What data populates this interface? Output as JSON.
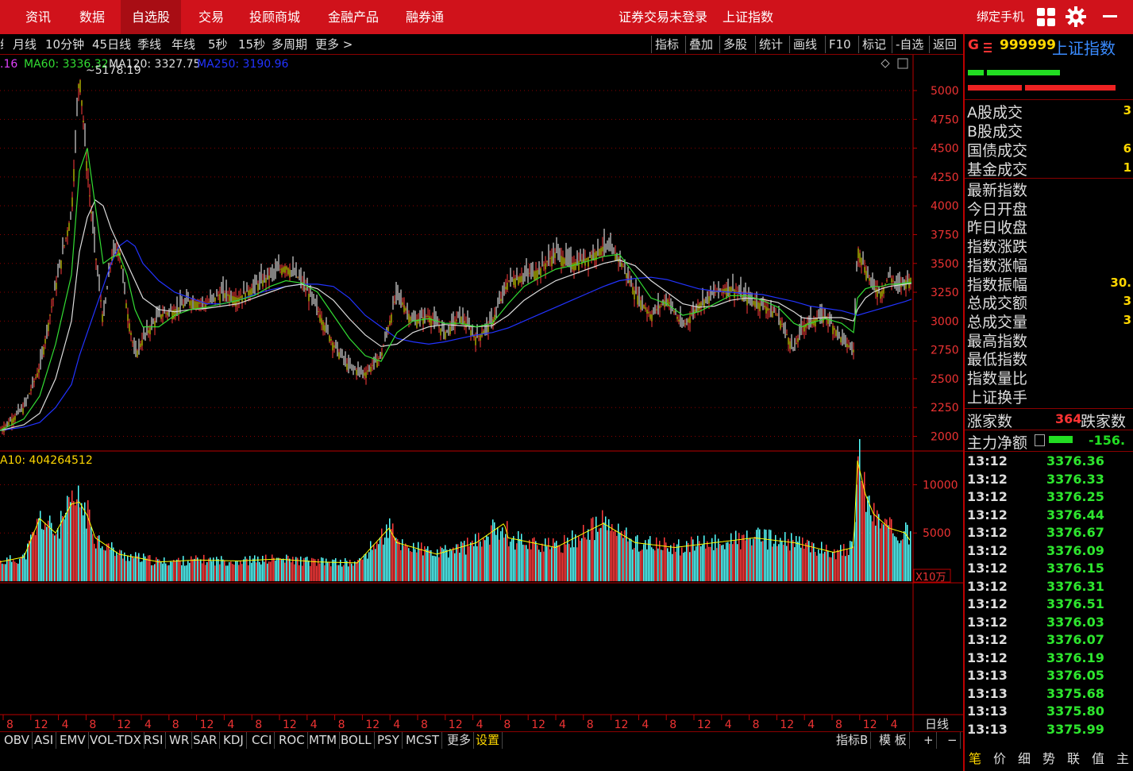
{
  "topbar": {
    "nav": [
      "资讯",
      "数据",
      "自选股",
      "交易",
      "投顾商城",
      "金融产品",
      "融券通"
    ],
    "active_index": 2,
    "login_status": "证券交易未登录",
    "index_name": "上证指数",
    "bind_phone": "绑定手机",
    "accent": "#d0121b"
  },
  "toolbar": {
    "periods": [
      "月线",
      "10分钟",
      "45日线",
      "季线",
      "年线",
      "5秒",
      "15秒",
      "多周期",
      "更多 >"
    ],
    "tools": [
      "指标",
      "叠加",
      "多股",
      "统计",
      "画线",
      "F10",
      "标记",
      "-自选",
      "返回"
    ]
  },
  "chart_data": [
    {
      "type": "line",
      "title": "",
      "legend": [
        {
          "name": ".16",
          "color": "#e040fb"
        },
        {
          "name": "MA60: 3336.32",
          "color": "#33dd33"
        },
        {
          "name": "MA120: 3327.75",
          "color": "#dddddd"
        },
        {
          "name": "MA250: 3190.96",
          "color": "#2233ff"
        }
      ],
      "ylim": [
        1900,
        5200
      ],
      "yticks": [
        5000,
        4750,
        4500,
        4250,
        4000,
        3750,
        3500,
        3250,
        3000,
        2750,
        2500,
        2250,
        2000
      ],
      "peak_label": "5178.19",
      "x": [
        0,
        30,
        50,
        70,
        90,
        100,
        110,
        120,
        130,
        140,
        150,
        160,
        170,
        180,
        200,
        220,
        240,
        260,
        280,
        300,
        320,
        340,
        360,
        380,
        400,
        420,
        440,
        460,
        480,
        500,
        520,
        540,
        560,
        580,
        600,
        620,
        640,
        660,
        680,
        700,
        720,
        740,
        760,
        780,
        800,
        820,
        840,
        860,
        880,
        900,
        920,
        940,
        960,
        980,
        1000,
        1010,
        1020,
        1040,
        1060,
        1075,
        1080,
        1090,
        1100,
        1110,
        1120,
        1130,
        1140,
        1148
      ],
      "close": [
        2050,
        2250,
        2600,
        3300,
        3950,
        5178,
        4300,
        3600,
        3000,
        3550,
        3650,
        3100,
        2700,
        2850,
        3050,
        3100,
        3180,
        3150,
        3250,
        3200,
        3300,
        3400,
        3480,
        3350,
        3100,
        2800,
        2600,
        2550,
        2700,
        3250,
        3000,
        3050,
        2900,
        3050,
        2850,
        3000,
        3350,
        3400,
        3450,
        3600,
        3500,
        3550,
        3650,
        3550,
        3250,
        3050,
        3200,
        2950,
        3150,
        3250,
        3300,
        3200,
        3150,
        3050,
        2750,
        2950,
        3000,
        3050,
        2850,
        2750,
        3650,
        3450,
        3300,
        3250,
        3400,
        3300,
        3350,
        3380
      ],
      "ma60": [
        2050,
        2150,
        2350,
        2800,
        3400,
        4300,
        4500,
        4000,
        3500,
        3550,
        3580,
        3400,
        3100,
        2950,
        2950,
        3050,
        3100,
        3120,
        3150,
        3180,
        3220,
        3300,
        3350,
        3330,
        3250,
        3050,
        2850,
        2700,
        2650,
        2900,
        3000,
        3020,
        2980,
        2980,
        2950,
        2980,
        3150,
        3300,
        3380,
        3450,
        3480,
        3520,
        3560,
        3580,
        3400,
        3200,
        3150,
        3050,
        3080,
        3150,
        3220,
        3220,
        3180,
        3120,
        2980,
        2950,
        2980,
        3020,
        2980,
        2900,
        3200,
        3280,
        3300,
        3300,
        3320,
        3320,
        3330,
        3336
      ],
      "ma120": [
        2050,
        2100,
        2200,
        2500,
        3000,
        3600,
        3900,
        4050,
        4000,
        3800,
        3650,
        3500,
        3350,
        3200,
        3100,
        3080,
        3100,
        3110,
        3130,
        3150,
        3200,
        3250,
        3300,
        3320,
        3280,
        3180,
        3020,
        2880,
        2780,
        2800,
        2900,
        2950,
        2970,
        2960,
        2950,
        2960,
        3050,
        3180,
        3270,
        3350,
        3400,
        3450,
        3500,
        3530,
        3480,
        3350,
        3250,
        3150,
        3120,
        3130,
        3180,
        3200,
        3190,
        3160,
        3080,
        3030,
        3020,
        3030,
        3030,
        3000,
        3100,
        3200,
        3250,
        3280,
        3300,
        3310,
        3320,
        3327
      ],
      "ma250": [
        2050,
        2080,
        2120,
        2250,
        2450,
        2700,
        2900,
        3100,
        3300,
        3500,
        3650,
        3700,
        3650,
        3500,
        3350,
        3250,
        3200,
        3150,
        3150,
        3180,
        3230,
        3270,
        3300,
        3320,
        3320,
        3300,
        3200,
        3050,
        2950,
        2850,
        2820,
        2800,
        2820,
        2850,
        2880,
        2900,
        2940,
        3000,
        3060,
        3120,
        3180,
        3240,
        3300,
        3350,
        3370,
        3380,
        3360,
        3320,
        3280,
        3260,
        3250,
        3240,
        3230,
        3200,
        3170,
        3150,
        3130,
        3110,
        3090,
        3060,
        3050,
        3070,
        3090,
        3110,
        3130,
        3150,
        3170,
        3190
      ]
    },
    {
      "type": "bar",
      "title": "",
      "legend_label": "A10: 404264512",
      "unit_label": "X10万",
      "ylim": [
        0,
        13000
      ],
      "yticks": [
        10000,
        5000
      ],
      "x": [
        0,
        30,
        50,
        70,
        90,
        100,
        110,
        120,
        150,
        200,
        250,
        300,
        350,
        400,
        450,
        490,
        500,
        550,
        600,
        635,
        640,
        700,
        760,
        800,
        850,
        900,
        950,
        1000,
        1050,
        1075,
        1080,
        1090,
        1100,
        1120,
        1140,
        1148
      ],
      "values": [
        2000,
        2500,
        6500,
        5000,
        8000,
        8200,
        6800,
        4500,
        2800,
        2000,
        2200,
        2100,
        2300,
        2000,
        1900,
        5500,
        4000,
        2800,
        4000,
        6000,
        4500,
        3500,
        6000,
        4000,
        3500,
        4000,
        4500,
        4000,
        3000,
        3500,
        12500,
        9000,
        7000,
        5500,
        5000,
        4000
      ]
    }
  ],
  "xaxis": {
    "labels": [
      "8",
      "12",
      "4",
      "8",
      "12",
      "4",
      "8",
      "12",
      "4",
      "8",
      "12",
      "4",
      "8",
      "12",
      "4",
      "8",
      "12",
      "4",
      "8",
      "12",
      "4",
      "8",
      "12",
      "4",
      "8",
      "12",
      "4",
      "8",
      "12",
      "4",
      "8",
      "12",
      "4"
    ],
    "period_label": "日线"
  },
  "bottom_tabs": [
    "OBV",
    "ASI",
    "EMV",
    "VOL-TDX",
    "RSI",
    "WR",
    "SAR",
    "KDJ",
    "CCI",
    "ROC",
    "MTM",
    "BOLL",
    "PSY",
    "MCST",
    "更多",
    "设置"
  ],
  "bottom_right": [
    "指标B",
    "模 板",
    "+",
    "−"
  ],
  "right_panel": {
    "code_prefix": "G",
    "code": "999999",
    "name": "上证指数",
    "stats_a": [
      {
        "label": "A股成交",
        "value": "3"
      },
      {
        "label": "B股成交",
        "value": ""
      },
      {
        "label": "国债成交",
        "value": "6"
      },
      {
        "label": "基金成交",
        "value": "1"
      }
    ],
    "stats_b": [
      {
        "label": "最新指数",
        "value": ""
      },
      {
        "label": "今日开盘",
        "value": ""
      },
      {
        "label": "昨日收盘",
        "value": ""
      },
      {
        "label": "指数涨跌",
        "value": ""
      },
      {
        "label": "指数涨幅",
        "value": ""
      },
      {
        "label": "指数振幅",
        "value": "30."
      },
      {
        "label": "总成交额",
        "value": "3"
      },
      {
        "label": "总成交量",
        "value": "3"
      },
      {
        "label": "最高指数",
        "value": ""
      },
      {
        "label": "最低指数",
        "value": ""
      },
      {
        "label": "指数量比",
        "value": ""
      },
      {
        "label": "上证换手",
        "value": ""
      }
    ],
    "up_label": "涨家数",
    "up_count": "364",
    "down_label": "跌家数",
    "main_fund_label": "主力净额",
    "main_fund_value": "-156.",
    "ticks": [
      {
        "t": "13:12",
        "p": "3376.36"
      },
      {
        "t": "13:12",
        "p": "3376.33"
      },
      {
        "t": "13:12",
        "p": "3376.25"
      },
      {
        "t": "13:12",
        "p": "3376.44"
      },
      {
        "t": "13:12",
        "p": "3376.67"
      },
      {
        "t": "13:12",
        "p": "3376.09"
      },
      {
        "t": "13:12",
        "p": "3376.15"
      },
      {
        "t": "13:12",
        "p": "3376.31"
      },
      {
        "t": "13:12",
        "p": "3376.51"
      },
      {
        "t": "13:12",
        "p": "3376.03"
      },
      {
        "t": "13:12",
        "p": "3376.07"
      },
      {
        "t": "13:12",
        "p": "3376.19"
      },
      {
        "t": "13:13",
        "p": "3376.05"
      },
      {
        "t": "13:13",
        "p": "3375.68"
      },
      {
        "t": "13:13",
        "p": "3375.80"
      },
      {
        "t": "13:13",
        "p": "3375.99"
      }
    ],
    "bottom_tabs": [
      "笔",
      "价",
      "细",
      "势",
      "联",
      "值",
      "主"
    ]
  }
}
